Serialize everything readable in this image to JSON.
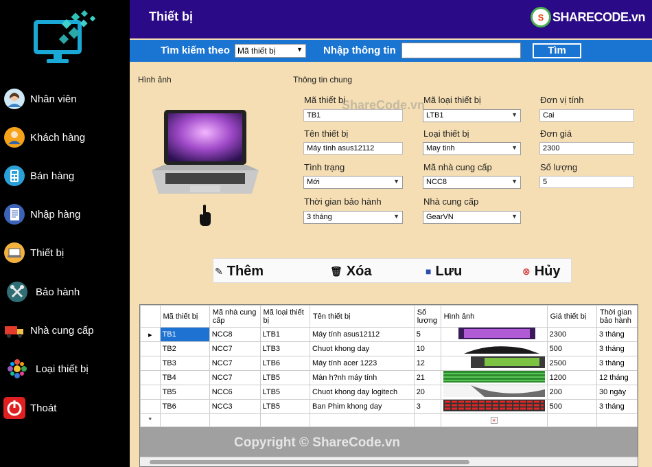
{
  "sidebar": {
    "items": [
      {
        "label": "Nhân viên",
        "icon": "person-icon"
      },
      {
        "label": "Khách hàng",
        "icon": "customer-icon"
      },
      {
        "label": "Bán hàng",
        "icon": "calculator-icon"
      },
      {
        "label": "Nhập hàng",
        "icon": "document-icon"
      },
      {
        "label": "Thiết bị",
        "icon": "laptop-icon"
      },
      {
        "label": "Bảo hành",
        "icon": "tools-icon"
      },
      {
        "label": "Nhà cung cấp",
        "icon": "truck-icon"
      },
      {
        "label": "Loại thiết bị",
        "icon": "flower-icon"
      },
      {
        "label": "Thoát",
        "icon": "power-icon"
      }
    ]
  },
  "header": {
    "title": "Thiết bị",
    "brand": "SHARECODE.vn",
    "brand_badge": "S"
  },
  "search": {
    "label_by": "Tìm kiếm theo",
    "selected": "Mã thiết bị",
    "label_input": "Nhập thông tin",
    "value": "",
    "button": "Tìm"
  },
  "image_panel": {
    "title": "Hình ảnh"
  },
  "info": {
    "title": "Thông tin chung",
    "ma_tb_label": "Mã thiết bị",
    "ma_tb": "TB1",
    "ma_loai_label": "Mã loại thiết bị",
    "ma_loai": "LTB1",
    "dvt_label": "Đơn vị tính",
    "dvt": "Cai",
    "ten_tb_label": "Tên thiết bị",
    "ten_tb": "Máy tính asus12112",
    "loai_tb_label": "Loại thiết bị",
    "loai_tb": "May tinh",
    "don_gia_label": "Đơn giá",
    "don_gia": "2300",
    "tinh_trang_label": "Tình trạng",
    "tinh_trang": "Mới",
    "ma_ncc_label": "Mã nhà cung cấp",
    "ma_ncc": "NCC8",
    "so_luong_label": "Số lượng",
    "so_luong": "5",
    "bao_hanh_label": "Thời gian bảo hành",
    "bao_hanh": "3 tháng",
    "ncc_label": "Nhà cung cấp",
    "ncc": "GearVN"
  },
  "actions": {
    "them": "Thêm",
    "xoa": "Xóa",
    "luu": "Lưu",
    "huy": "Hủy"
  },
  "grid": {
    "headers": [
      "Mã thiết bị",
      "Mã nhà cung cấp",
      "Mã loại thiết bị",
      "Tên thiết bị",
      "Số lượng",
      "Hình ảnh",
      "Giá thiết bị",
      "Thời gian bảo hành"
    ],
    "rows": [
      {
        "ma": "TB1",
        "ncc": "NCC8",
        "loai": "LTB1",
        "ten": "Máy tính asus12112",
        "sl": "5",
        "gia": "2300",
        "tg": "3 tháng"
      },
      {
        "ma": "TB2",
        "ncc": "NCC7",
        "loai": "LTB3",
        "ten": "Chuot khong day",
        "sl": "10",
        "gia": "500",
        "tg": "3 tháng"
      },
      {
        "ma": "TB3",
        "ncc": "NCC7",
        "loai": "LTB6",
        "ten": "Máy tính acer 1223",
        "sl": "12",
        "gia": "2500",
        "tg": "3 tháng"
      },
      {
        "ma": "TB4",
        "ncc": "NCC7",
        "loai": "LTB5",
        "ten": "Màn h?nh máy tính",
        "sl": "21",
        "gia": "1200",
        "tg": "12 tháng"
      },
      {
        "ma": "TB5",
        "ncc": "NCC6",
        "loai": "LTB5",
        "ten": "Chuot khong day logitech",
        "sl": "20",
        "gia": "200",
        "tg": "30 ngày"
      },
      {
        "ma": "TB6",
        "ncc": "NCC3",
        "loai": "LTB5",
        "ten": "Ban Phim khong day",
        "sl": "3",
        "gia": "500",
        "tg": "3 tháng"
      }
    ],
    "new_row_marker": "*",
    "current_row_marker": "▸"
  },
  "copyright": "Copyright © ShareCode.vn",
  "watermark": "ShareCode.vn",
  "colors": {
    "sidebar": "#000000",
    "titlebar": "#2a0a86",
    "searchbar": "#1a75d2",
    "content": "#f5deb3",
    "selection": "#1e72d1"
  }
}
